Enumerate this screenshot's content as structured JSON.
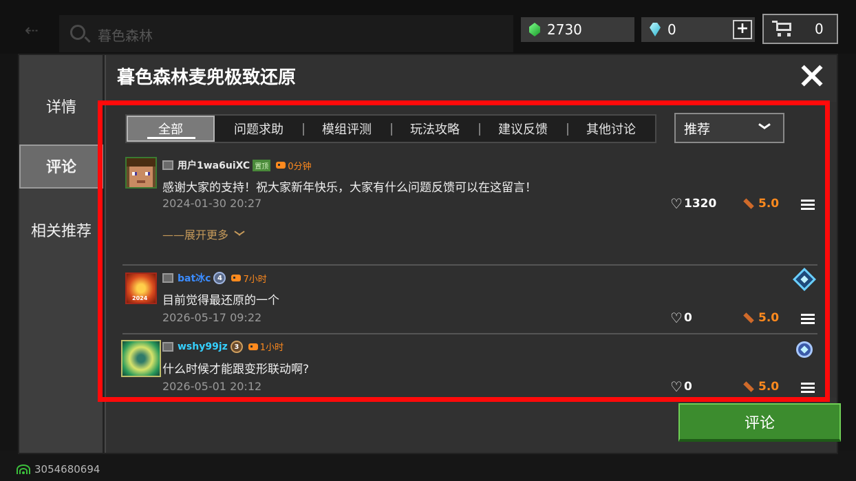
{
  "background": {
    "search_placeholder": "暮色森林",
    "emeralds": "2730",
    "diamonds": "0",
    "add_label": "+",
    "cart_count": "0",
    "user_id": "3054680694"
  },
  "modal": {
    "title": "暮色森林麦兜极致还原",
    "sidebar": [
      {
        "label": "详情"
      },
      {
        "label": "评论"
      },
      {
        "label": "相关推荐"
      }
    ],
    "active_sidebar": "评论",
    "tabs": [
      {
        "label": "全部"
      },
      {
        "label": "问题求助"
      },
      {
        "label": "模组评测"
      },
      {
        "label": "玩法攻略"
      },
      {
        "label": "建议反馈"
      },
      {
        "label": "其他讨论"
      }
    ],
    "active_tab": "全部",
    "sort_label": "推荐",
    "comments": [
      {
        "user": "用户1wa6uiXC",
        "pinned_label": "置顶",
        "time": "0分钟",
        "text": "感谢大家的支持！祝大家新年快乐，大家有什么问题反馈可以在这留言！",
        "date": "2024-01-30 20:27",
        "likes": "1320",
        "rating": "5.0",
        "expand_label": "——展开更多"
      },
      {
        "user": "bat冰c",
        "level": "4",
        "time": "7小时",
        "text": "目前觉得最还原的一个",
        "date": "2026-05-17 09:22",
        "likes": "0",
        "rating": "5.0",
        "avatar_caption": "2024"
      },
      {
        "user": "wshy99jz",
        "level": "3",
        "time": "1小时",
        "text": "什么时候才能跟变形联动啊?",
        "date": "2026-05-01 20:12",
        "likes": "0",
        "rating": "5.0"
      }
    ],
    "comment_button": "评论"
  },
  "colors": {
    "highlight": "#ff0a0a",
    "accent_green": "#3c8c2e",
    "rating_orange": "#ff8a1e"
  }
}
